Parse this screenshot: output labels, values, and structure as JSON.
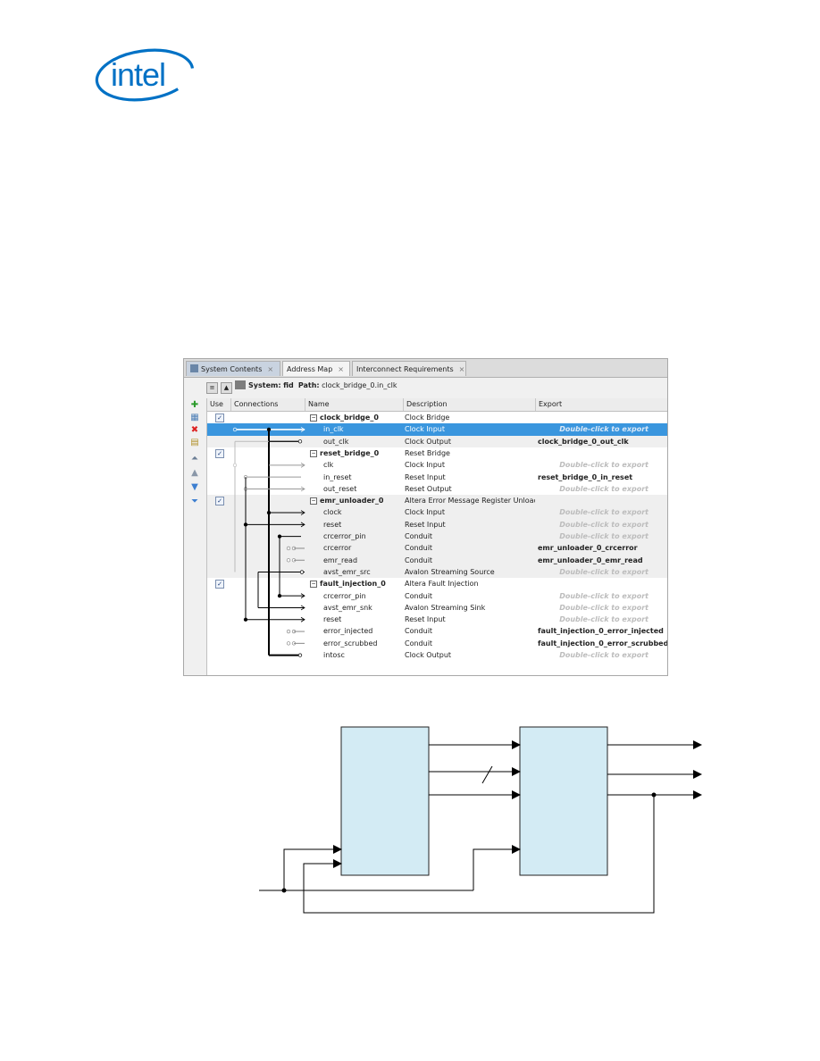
{
  "logo": {
    "text": "intel",
    "color": "#0071c5"
  },
  "tabs": [
    {
      "label": "System Contents",
      "active": true
    },
    {
      "label": "Address Map",
      "active": false
    },
    {
      "label": "Interconnect Requirements",
      "active": false
    }
  ],
  "path_bar": {
    "system_label": "System:",
    "system_name": "fid",
    "path_label": "Path:",
    "path_value": "clock_bridge_0.in_clk"
  },
  "columns": [
    "Use",
    "Connections",
    "Name",
    "Description",
    "Export"
  ],
  "export_hint": "Double-click to export",
  "rows": [
    {
      "name": "clock_bridge_0",
      "description": "Clock Bridge",
      "export": "",
      "group": true,
      "use": true
    },
    {
      "name": "in_clk",
      "description": "Clock Input",
      "export": "",
      "selected": true
    },
    {
      "name": "out_clk",
      "description": "Clock Output",
      "export": "clock_bridge_0_out_clk"
    },
    {
      "name": "reset_bridge_0",
      "description": "Reset Bridge",
      "export": "",
      "group": true,
      "use": true
    },
    {
      "name": "clk",
      "description": "Clock Input",
      "export": ""
    },
    {
      "name": "in_reset",
      "description": "Reset Input",
      "export": "reset_bridge_0_in_reset"
    },
    {
      "name": "out_reset",
      "description": "Reset Output",
      "export": ""
    },
    {
      "name": "emr_unloader_0",
      "description": "Altera Error Message Register Unloader",
      "export": "",
      "group": true,
      "use": true
    },
    {
      "name": "clock",
      "description": "Clock Input",
      "export": ""
    },
    {
      "name": "reset",
      "description": "Reset Input",
      "export": ""
    },
    {
      "name": "crcerror_pin",
      "description": "Conduit",
      "export": ""
    },
    {
      "name": "crcerror",
      "description": "Conduit",
      "export": "emr_unloader_0_crcerror"
    },
    {
      "name": "emr_read",
      "description": "Conduit",
      "export": "emr_unloader_0_emr_read"
    },
    {
      "name": "avst_emr_src",
      "description": "Avalon Streaming Source",
      "export": ""
    },
    {
      "name": "fault_injection_0",
      "description": "Altera Fault Injection",
      "export": "",
      "group": true,
      "use": true
    },
    {
      "name": "crcerror_pin",
      "description": "Conduit",
      "export": ""
    },
    {
      "name": "avst_emr_snk",
      "description": "Avalon Streaming Sink",
      "export": ""
    },
    {
      "name": "reset",
      "description": "Reset Input",
      "export": ""
    },
    {
      "name": "error_injected",
      "description": "Conduit",
      "export": "fault_injection_0_error_injected"
    },
    {
      "name": "error_scrubbed",
      "description": "Conduit",
      "export": "fault_injection_0_error_scrubbed"
    },
    {
      "name": "intosc",
      "description": "Clock Output",
      "export": ""
    }
  ]
}
